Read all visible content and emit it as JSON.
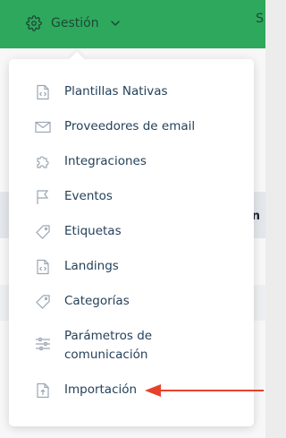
{
  "header": {
    "menu_label": "Gestión",
    "menu_icon": "gear-icon",
    "right_fragment": "S",
    "color": "#2ea85d"
  },
  "background": {
    "fragment": "n"
  },
  "menu": {
    "items": [
      {
        "label": "Plantillas Nativas",
        "icon": "code-file-icon"
      },
      {
        "label": "Proveedores de email",
        "icon": "envelope-icon"
      },
      {
        "label": "Integraciones",
        "icon": "puzzle-icon"
      },
      {
        "label": "Eventos",
        "icon": "flag-icon"
      },
      {
        "label": "Etiquetas",
        "icon": "tag-icon"
      },
      {
        "label": "Landings",
        "icon": "code-file-icon"
      },
      {
        "label": "Categorías",
        "icon": "tag-icon"
      },
      {
        "label": "Parámetros de comunicación",
        "icon": "sliders-icon"
      },
      {
        "label": "Importación",
        "icon": "upload-file-icon"
      }
    ]
  },
  "annotation": {
    "arrow_color": "#e8412c",
    "points_to": "Importación"
  }
}
